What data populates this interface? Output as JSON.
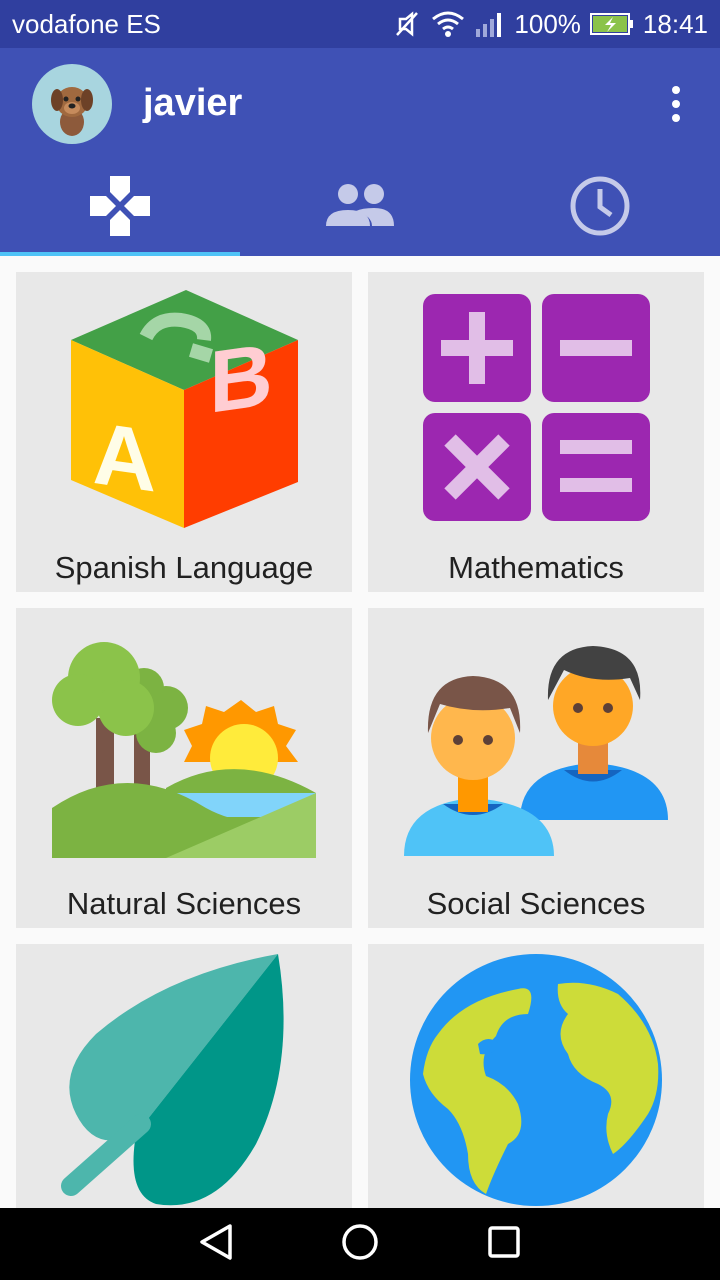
{
  "status_bar": {
    "carrier": "vodafone ES",
    "battery": "100%",
    "time": "18:41",
    "icons": [
      "mute-icon",
      "wifi-icon",
      "signal-icon",
      "battery-charging-icon"
    ]
  },
  "header": {
    "username": "javier",
    "avatar": "dog-avatar",
    "menu_icon": "more-vert-icon"
  },
  "tabs": [
    {
      "icon": "gamepad-icon",
      "selected": true
    },
    {
      "icon": "people-icon",
      "selected": false
    },
    {
      "icon": "clock-icon",
      "selected": false
    }
  ],
  "accent_colors": {
    "status_bar": "#303f9f",
    "app_bar": "#3f51b5",
    "tab_indicator": "#4fc3f7",
    "card_bg": "#e8e8e8"
  },
  "subjects": [
    {
      "label": "Spanish Language",
      "icon": "abc-block-icon"
    },
    {
      "label": "Mathematics",
      "icon": "calculator-icon"
    },
    {
      "label": "Natural Sciences",
      "icon": "landscape-icon"
    },
    {
      "label": "Social Sciences",
      "icon": "people-icon"
    },
    {
      "label": "",
      "icon": "leaf-icon"
    },
    {
      "label": "",
      "icon": "globe-icon"
    }
  ],
  "nav_bar": {
    "icons": [
      "back-icon",
      "home-icon",
      "recents-icon"
    ]
  }
}
